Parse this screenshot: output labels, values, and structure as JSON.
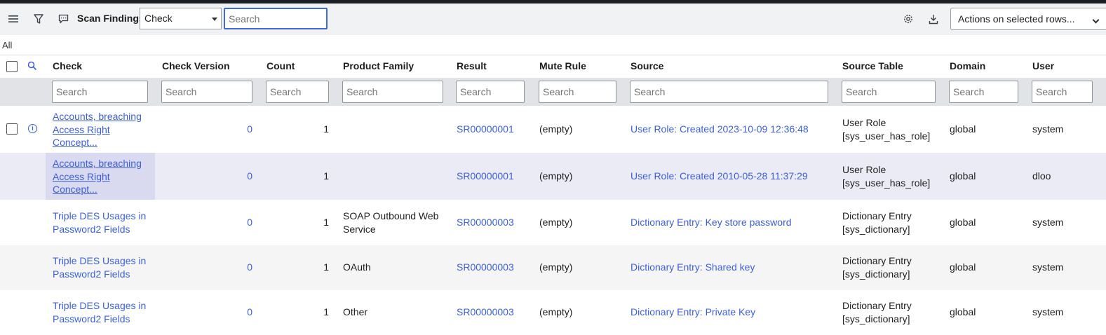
{
  "toolbar": {
    "title": "Scan Findings",
    "field_select_value": "Check",
    "search_placeholder": "Search",
    "actions_label": "Actions on selected rows..."
  },
  "breadcrumb": "All",
  "columns": [
    "Check",
    "Check Version",
    "Count",
    "Product Family",
    "Result",
    "Mute Rule",
    "Source",
    "Source Table",
    "Domain",
    "User"
  ],
  "filter_placeholder": "Search",
  "rows": [
    {
      "check": [
        "Accounts, breaching",
        "Access Right",
        "Concept..."
      ],
      "check_version": "0",
      "count": "1",
      "product_family": [],
      "result": "SR00000001",
      "mute_rule": "(empty)",
      "source": "User Role: Created 2023-10-09 12:36:48",
      "source_table": [
        "User Role",
        "[sys_user_has_role]"
      ],
      "domain": "global",
      "user": "system"
    },
    {
      "check": [
        "Accounts, breaching",
        "Access Right",
        "Concept..."
      ],
      "check_version": "0",
      "count": "1",
      "product_family": [],
      "result": "SR00000001",
      "mute_rule": "(empty)",
      "source": "User Role: Created 2010-05-28 11:37:29",
      "source_table": [
        "User Role",
        "[sys_user_has_role]"
      ],
      "domain": "global",
      "user": "dloo"
    },
    {
      "check": [
        "Triple DES Usages in",
        "Password2 Fields"
      ],
      "check_version": "0",
      "count": "1",
      "product_family": [
        "SOAP Outbound Web",
        "Service"
      ],
      "result": "SR00000003",
      "mute_rule": "(empty)",
      "source": "Dictionary Entry: Key store password",
      "source_table": [
        "Dictionary Entry",
        "[sys_dictionary]"
      ],
      "domain": "global",
      "user": "system"
    },
    {
      "check": [
        "Triple DES Usages in",
        "Password2 Fields"
      ],
      "check_version": "0",
      "count": "1",
      "product_family": [
        "OAuth"
      ],
      "result": "SR00000003",
      "mute_rule": "(empty)",
      "source": "Dictionary Entry: Shared key",
      "source_table": [
        "Dictionary Entry",
        "[sys_dictionary]"
      ],
      "domain": "global",
      "user": "system"
    },
    {
      "check": [
        "Triple DES Usages in",
        "Password2 Fields"
      ],
      "check_version": "0",
      "count": "1",
      "product_family": [
        "Other"
      ],
      "result": "SR00000003",
      "mute_rule": "(empty)",
      "source": "Dictionary Entry: Private Key",
      "source_table": [
        "Dictionary Entry",
        "[sys_dictionary]"
      ],
      "domain": "global",
      "user": "system"
    }
  ],
  "colors": {
    "link": "#3d5fd6",
    "toolbar_bg": "#f1f2f3",
    "filter_bg": "#e2e3e6",
    "hover_row": "#ebebf5",
    "hover_cell": "#d9daf0"
  }
}
